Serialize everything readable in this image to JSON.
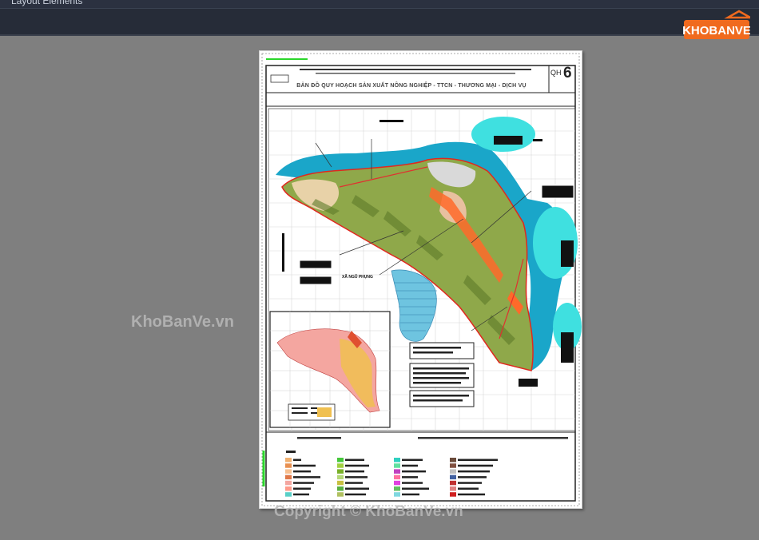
{
  "window": {
    "title": "Layout Elements"
  },
  "brand": {
    "logo_text": "KHOBANVE",
    "watermark": "KhoBanVe.vn",
    "copyright": "Copyright © KhoBanVe.vn"
  },
  "drawing": {
    "title": "BẢN ĐỒ QUY HOẠCH SẢN XUẤT NÔNG NGHIỆP - TTCN - THƯƠNG MẠI - DỊCH VỤ",
    "sheet_code": "QH",
    "sheet_number": "6",
    "commune_label": "XÃ NGŨ PHỤNG"
  },
  "colors": {
    "app_background": "#7f7f7f",
    "toolbar": "#262c38",
    "sea": "#1aa6c9",
    "lagoon": "#3fe0e0",
    "agriculture": "#8fa84a",
    "residential": "#e8d2a8",
    "boundary": "#e0281e",
    "logo_orange": "#f06a1e"
  },
  "legend_swatches": [
    [
      "#f0b070",
      "#e89050",
      "#f8c090",
      "#e07848",
      "#f4a6a0",
      "#ff9a8a",
      "#5ad0c8"
    ],
    [
      "#46c83c",
      "#a0d040",
      "#78b028",
      "#b4d878",
      "#c8c040",
      "#58b040",
      "#b0c060"
    ],
    [
      "#30d0c0",
      "#60e0a0",
      "#c040c0",
      "#ff70a0",
      "#e040e0",
      "#60c060",
      "#80d8e0"
    ],
    [
      "#6a4a3a",
      "#805040",
      "#c0c0c0",
      "#4060a0",
      "#c03030",
      "#e08080",
      "#d02020"
    ]
  ]
}
